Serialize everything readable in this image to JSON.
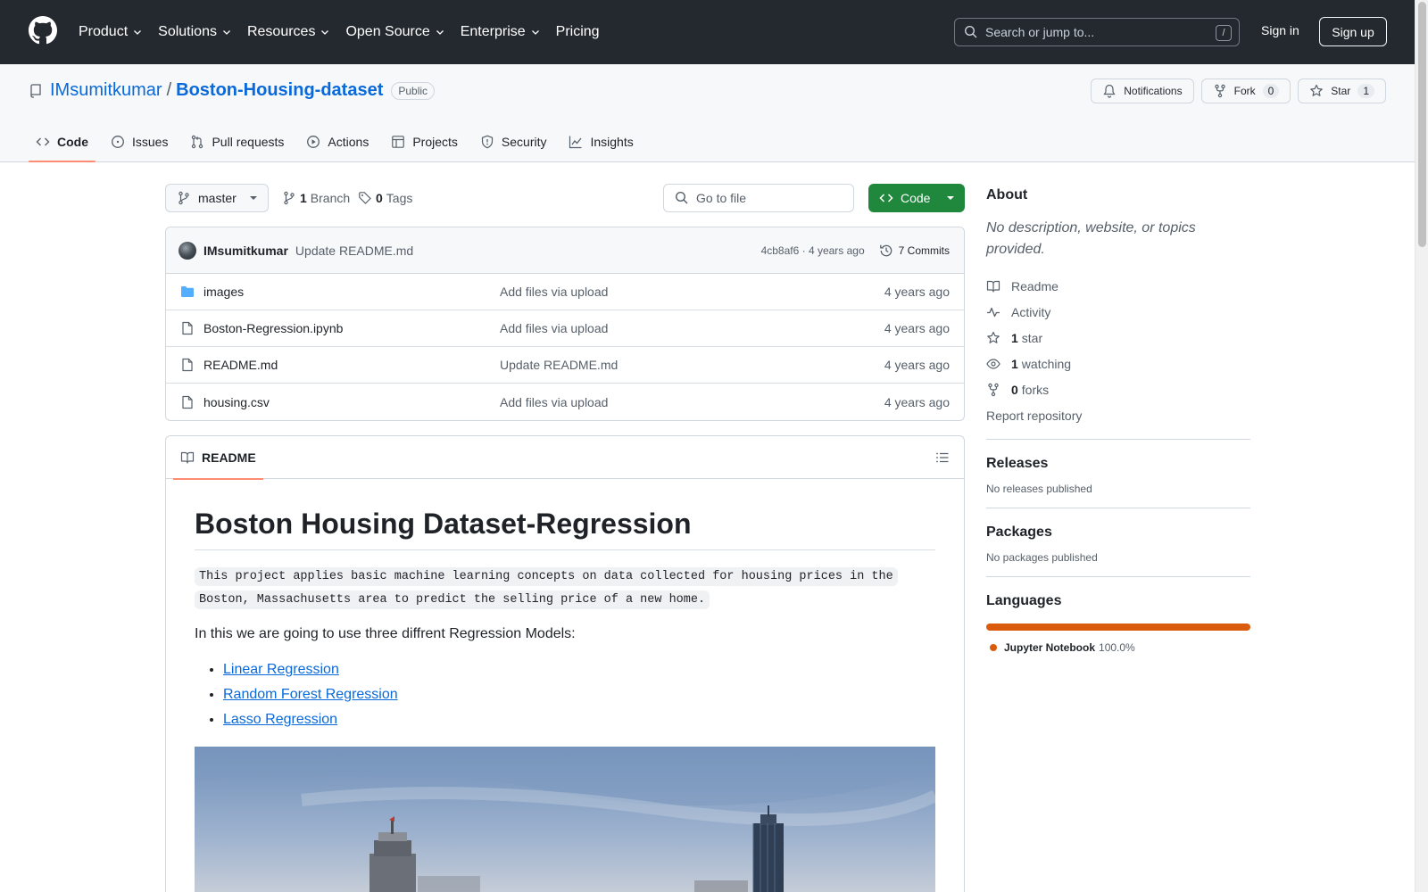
{
  "header": {
    "nav": [
      "Product",
      "Solutions",
      "Resources",
      "Open Source",
      "Enterprise",
      "Pricing"
    ],
    "search_placeholder": "Search or jump to...",
    "search_shortcut": "/",
    "signin": "Sign in",
    "signup": "Sign up"
  },
  "repo": {
    "owner": "IMsumitkumar",
    "separator": "/",
    "name": "Boston-Housing-dataset",
    "visibility": "Public",
    "notifications_label": "Notifications",
    "fork_label": "Fork",
    "fork_count": "0",
    "star_label": "Star",
    "star_count": "1",
    "tabs": [
      "Code",
      "Issues",
      "Pull requests",
      "Actions",
      "Projects",
      "Security",
      "Insights"
    ]
  },
  "toolbar": {
    "branch": "master",
    "branch_count": "1",
    "branch_label": "Branch",
    "tag_count": "0",
    "tag_label": "Tags",
    "goto_placeholder": "Go to file",
    "code_button": "Code"
  },
  "commit": {
    "author": "IMsumitkumar",
    "message": "Update README.md",
    "meta": "4cb8af6 · 4 years ago",
    "commits_label": "7 Commits"
  },
  "files": [
    {
      "name": "images",
      "type": "folder",
      "message": "Add files via upload",
      "age": "4 years ago"
    },
    {
      "name": "Boston-Regression.ipynb",
      "type": "file",
      "message": "Add files via upload",
      "age": "4 years ago"
    },
    {
      "name": "README.md",
      "type": "file",
      "message": "Update README.md",
      "age": "4 years ago"
    },
    {
      "name": "housing.csv",
      "type": "file",
      "message": "Add files via upload",
      "age": "4 years ago"
    }
  ],
  "readme": {
    "tab_label": "README",
    "title": "Boston Housing Dataset-Regression",
    "code_line1": "This project applies basic machine learning concepts on data collected for housing prices in the",
    "code_line2": "Boston, Massachusetts area to predict the selling price of a new home.",
    "intro": "In this we are going to use three diffrent Regression Models:",
    "models": [
      "Linear Regression",
      "Random Forest Regression",
      "Lasso Regression"
    ]
  },
  "sidebar": {
    "about_title": "About",
    "about_desc": "No description, website, or topics provided.",
    "links": [
      {
        "icon": "book-icon",
        "count": "",
        "label": "Readme"
      },
      {
        "icon": "pulse-icon",
        "count": "",
        "label": "Activity"
      },
      {
        "icon": "star-icon",
        "count": "1",
        "label": "star"
      },
      {
        "icon": "eye-icon",
        "count": "1",
        "label": "watching"
      },
      {
        "icon": "fork-icon",
        "count": "0",
        "label": "forks"
      }
    ],
    "report": "Report repository",
    "releases_title": "Releases",
    "releases_text": "No releases published",
    "packages_title": "Packages",
    "packages_text": "No packages published",
    "languages_title": "Languages",
    "language": {
      "name": "Jupyter Notebook",
      "percent": "100.0%",
      "color": "#da5b0b"
    }
  },
  "colors": {
    "header_bg": "#24292f",
    "link": "#0969da",
    "code_button": "#1f883d",
    "active_tab_underline": "#fd8c73"
  }
}
